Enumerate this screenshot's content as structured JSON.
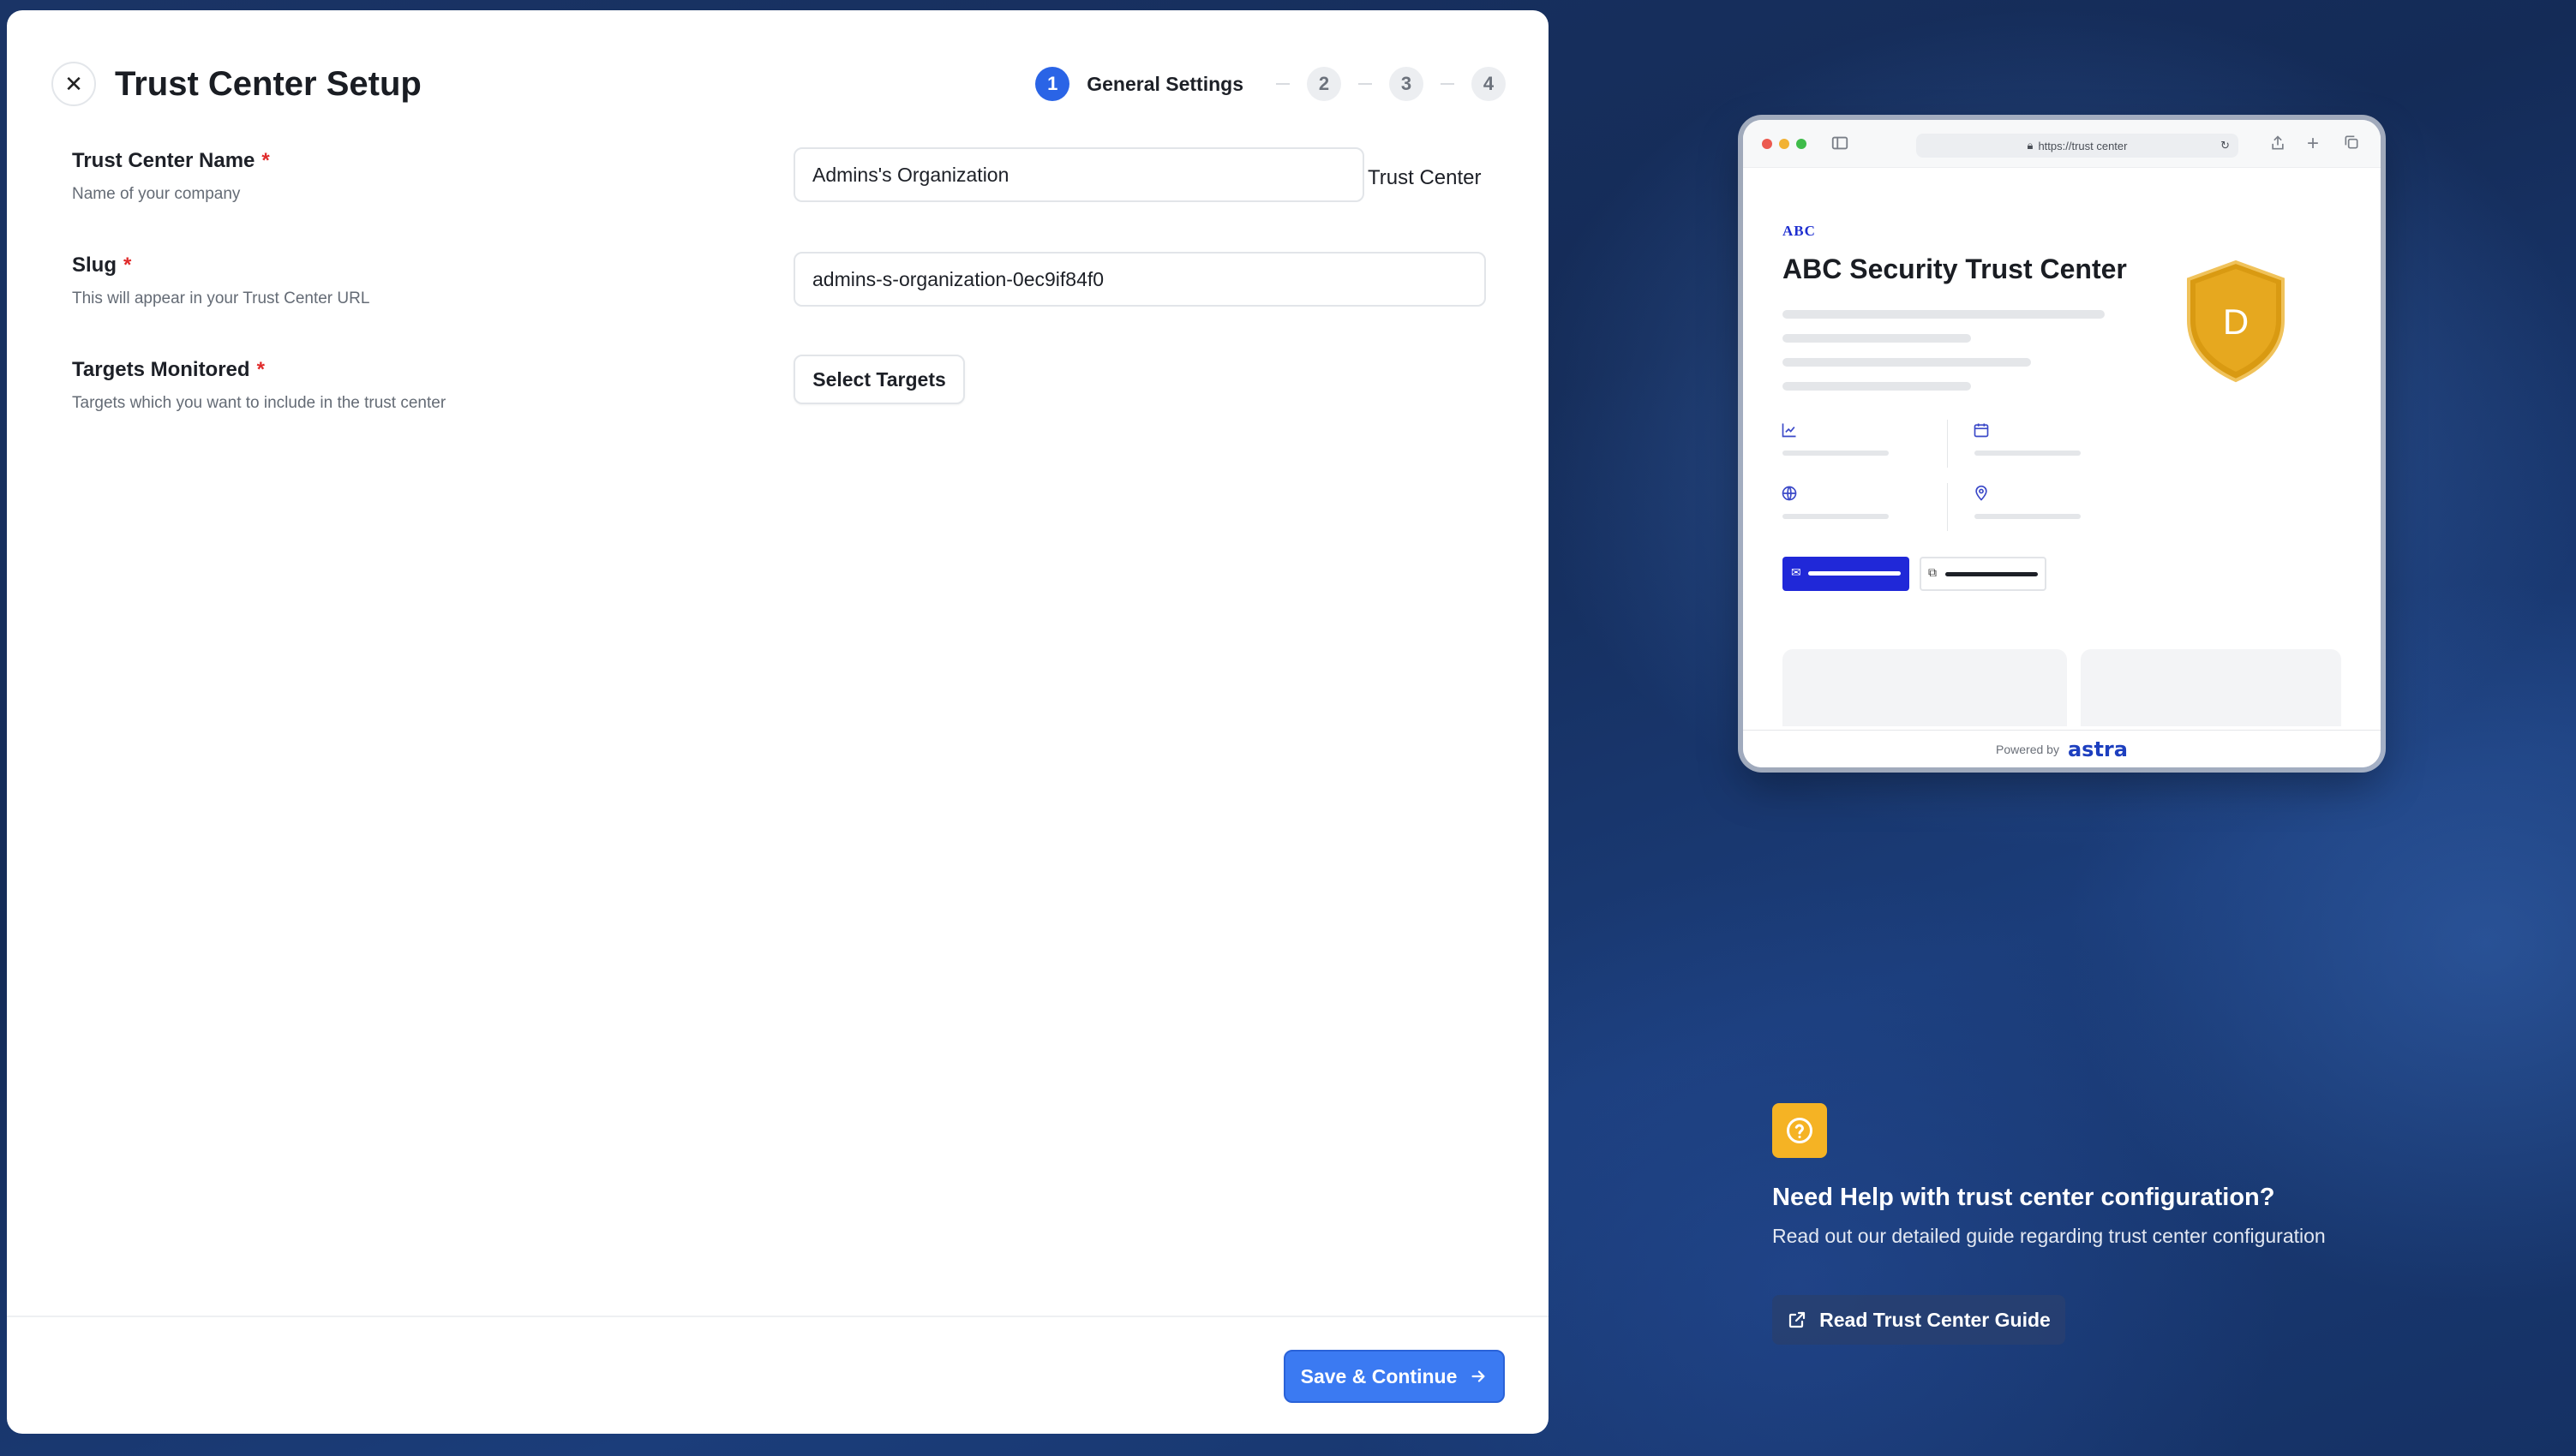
{
  "modal": {
    "title": "Trust Center Setup",
    "close_icon": "close-icon"
  },
  "stepper": {
    "steps": [
      {
        "number": "1",
        "label": "General Settings",
        "active": true
      },
      {
        "number": "2",
        "label": "",
        "active": false
      },
      {
        "number": "3",
        "label": "",
        "active": false
      },
      {
        "number": "4",
        "label": "",
        "active": false
      }
    ]
  },
  "form": {
    "name": {
      "label": "Trust Center Name",
      "required_mark": "*",
      "help": "Name of your company",
      "value": "Admins's Organization",
      "suffix": "Trust Center"
    },
    "slug": {
      "label": "Slug",
      "required_mark": "*",
      "help": "This will appear in your Trust Center URL",
      "value": "admins-s-organization-0ec9if84f0"
    },
    "targets": {
      "label": "Targets Monitored",
      "required_mark": "*",
      "help": "Targets which you want to include in the trust center",
      "button_label": "Select Targets"
    }
  },
  "footer": {
    "save_label": "Save & Continue"
  },
  "preview": {
    "url": "https://trust center",
    "logo_text": "ABC",
    "title": "ABC Security Trust Center",
    "shield_letter": "D",
    "powered_by": "Powered by",
    "brand": "astra",
    "colors": {
      "primary": "#2028d8",
      "shield": "#e2a21c"
    }
  },
  "help": {
    "title": "Need Help with trust center configuration?",
    "text": "Read out our detailed guide regarding trust center configuration",
    "button_label": "Read Trust Center Guide",
    "icon_color": "#f5b324"
  }
}
